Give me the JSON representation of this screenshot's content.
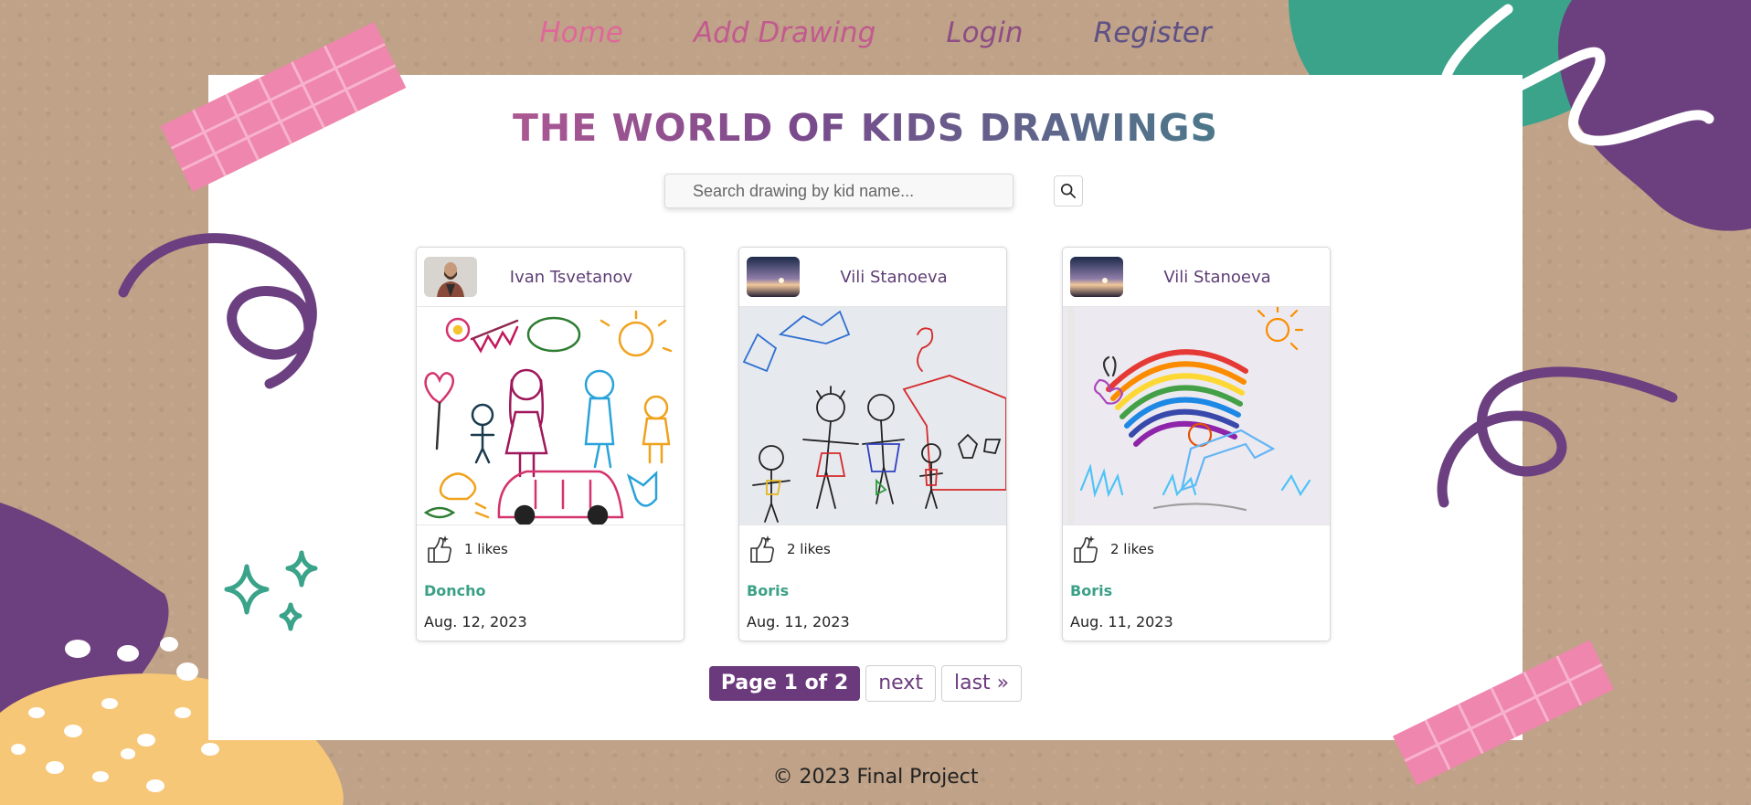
{
  "nav": {
    "home": "Home",
    "add_drawing": "Add Drawing",
    "login": "Login",
    "register": "Register"
  },
  "title": "THE WORLD OF KIDS DRAWINGS",
  "search": {
    "placeholder": "Search drawing by kid name...",
    "value": ""
  },
  "cards": [
    {
      "author": "Ivan Tsvetanov",
      "likes": "1 likes",
      "kid": "Doncho",
      "date": "Aug. 12, 2023"
    },
    {
      "author": "Vili Stanoeva",
      "likes": "2 likes",
      "kid": "Boris",
      "date": "Aug. 11, 2023"
    },
    {
      "author": "Vili Stanoeva",
      "likes": "2 likes",
      "kid": "Boris",
      "date": "Aug. 11, 2023"
    }
  ],
  "pagination": {
    "current": "Page 1 of 2",
    "next": "next",
    "last": "last »"
  },
  "footer": "© 2023 Final Project",
  "colors": {
    "pink": "#e0679a",
    "purple": "#6b3a7d",
    "teal": "#3aa086",
    "yellow": "#f7c778"
  },
  "icons": [
    "search-icon",
    "thumbs-up-icon"
  ]
}
